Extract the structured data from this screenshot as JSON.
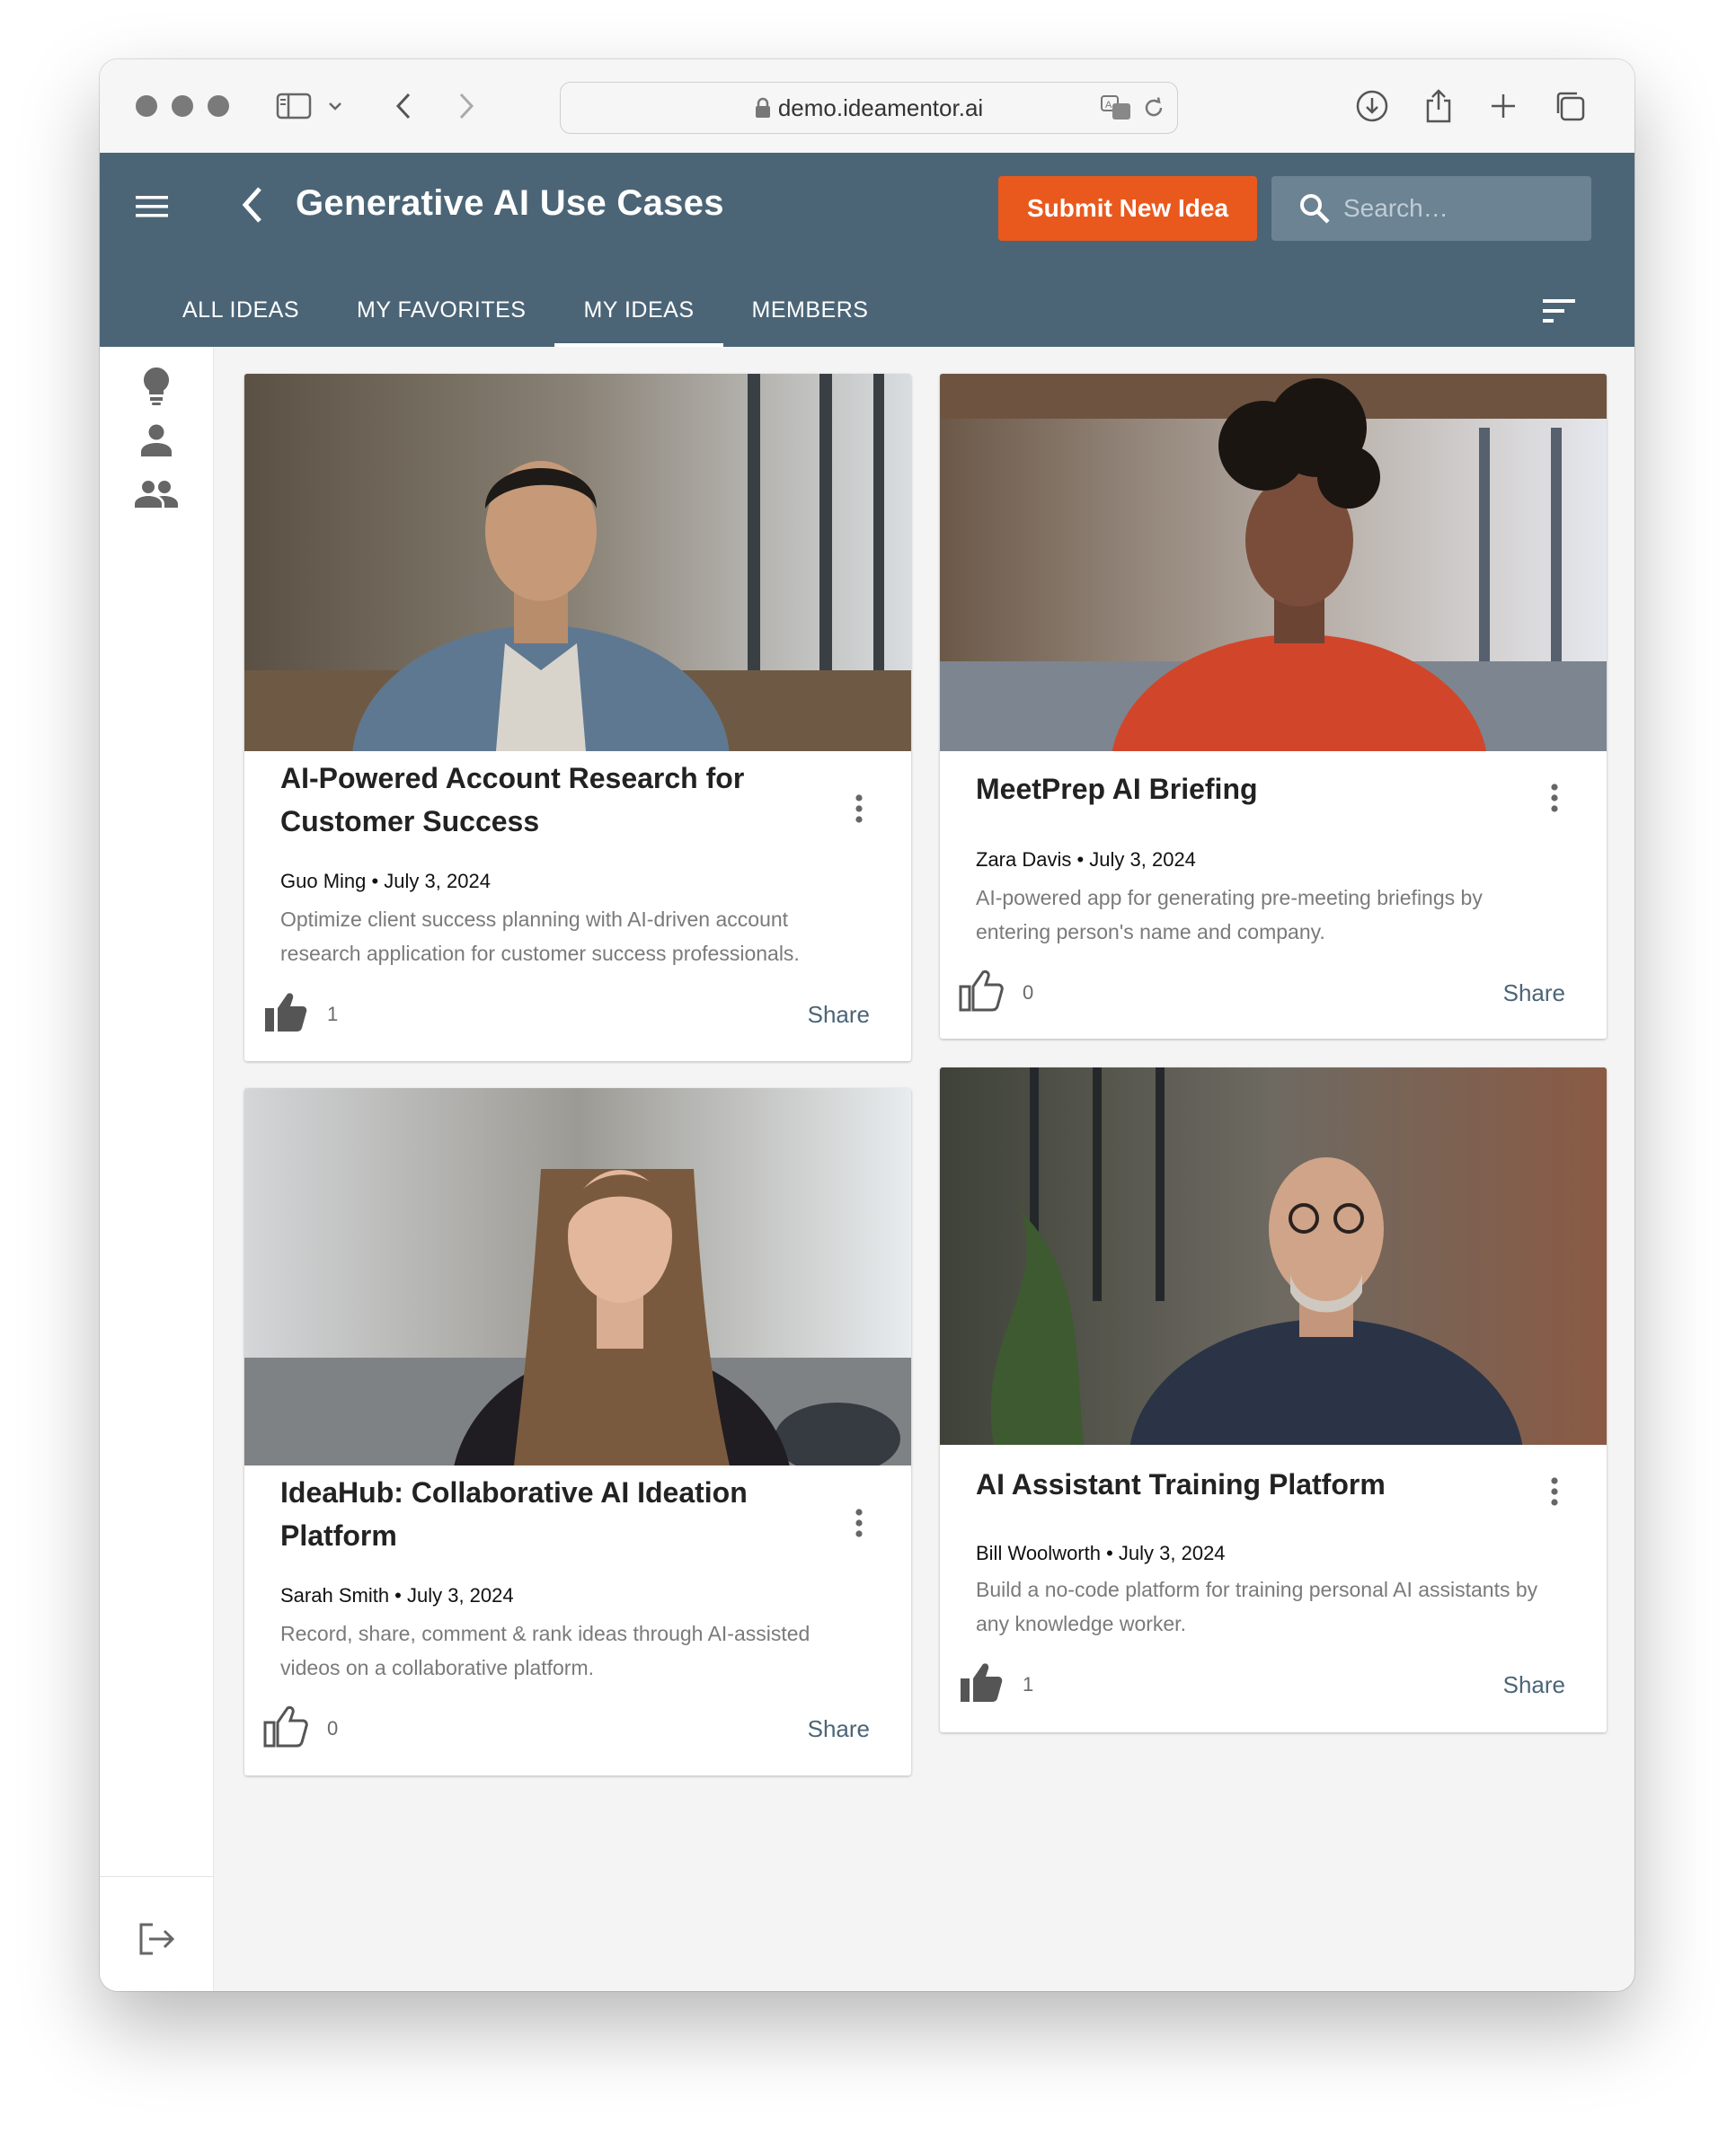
{
  "browser": {
    "url": "demo.ideamentor.ai"
  },
  "app": {
    "title": "Generative AI Use Cases",
    "submit_label": "Submit New Idea",
    "search_placeholder": "Search…"
  },
  "tabs": [
    {
      "label": "ALL IDEAS",
      "active": false
    },
    {
      "label": "MY FAVORITES",
      "active": false
    },
    {
      "label": "MY IDEAS",
      "active": true
    },
    {
      "label": "MEMBERS",
      "active": false
    }
  ],
  "sidebar": {
    "items": [
      {
        "icon": "lightbulb-icon"
      },
      {
        "icon": "person-icon"
      },
      {
        "icon": "group-icon"
      }
    ],
    "logout_icon": "logout-icon"
  },
  "cards": [
    {
      "title_line1": "AI-Powered Account Research for",
      "title_line2": "Customer Success",
      "meta": "Guo Ming • July 3, 2024",
      "desc_line1": "Optimize client success planning with AI-driven account",
      "desc_line2": "research application for customer success professionals.",
      "likes": "1",
      "liked": true,
      "share": "Share"
    },
    {
      "title_line1": "MeetPrep AI Briefing",
      "meta": "Zara Davis • July 3, 2024",
      "desc_line1": "AI-powered app for generating pre-meeting briefings by",
      "desc_line2": "entering person's name and company.",
      "likes": "0",
      "liked": false,
      "share": "Share"
    },
    {
      "title_line1": "IdeaHub: Collaborative AI Ideation",
      "title_line2": "Platform",
      "meta": "Sarah Smith • July 3, 2024",
      "desc_line1": "Record, share, comment & rank ideas through AI-assisted",
      "desc_line2": "videos on a collaborative platform.",
      "likes": "0",
      "liked": false,
      "share": "Share"
    },
    {
      "title_line1": "AI Assistant Training Platform",
      "meta": "Bill Woolworth • July 3, 2024",
      "desc_line1": "Build a no-code platform for training personal AI assistants by",
      "desc_line2": "any knowledge worker.",
      "likes": "1",
      "liked": true,
      "share": "Share"
    }
  ],
  "colors": {
    "header": "#4b6577",
    "accent": "#e9591d"
  }
}
